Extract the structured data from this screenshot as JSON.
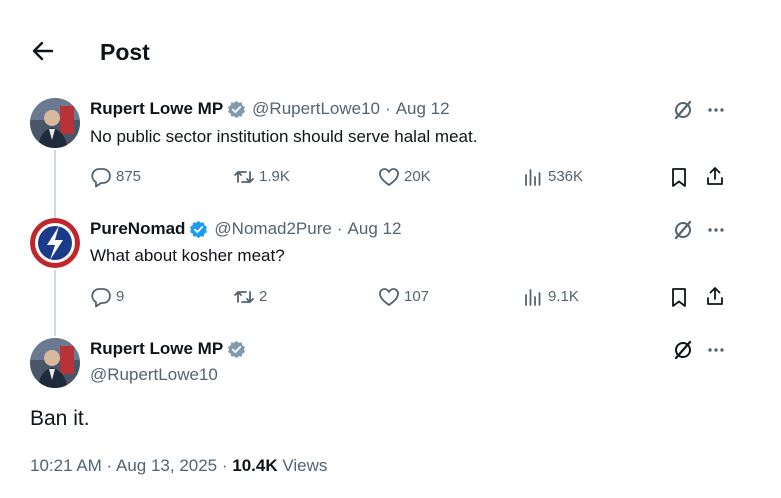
{
  "header": {
    "title": "Post"
  },
  "tweets": [
    {
      "display_name": "Rupert Lowe MP",
      "handle": "@RupertLowe10",
      "date": "Aug 12",
      "text": "No public sector institution should serve halal meat.",
      "replies": "875",
      "retweets": "1.9K",
      "likes": "20K",
      "views": "536K"
    },
    {
      "display_name": "PureNomad",
      "handle": "@Nomad2Pure",
      "date": "Aug 12",
      "text": "What about kosher meat?",
      "replies": "9",
      "retweets": "2",
      "likes": "107",
      "views": "9.1K"
    }
  ],
  "main_tweet": {
    "display_name": "Rupert Lowe MP",
    "handle": "@RupertLowe10",
    "text": "Ban it.",
    "timestamp": "10:21 AM · Aug 13, 2025 · ",
    "view_count": "10.4K",
    "views_label": " Views"
  },
  "separator": "·",
  "colors": {
    "verified": "#1d9bf0",
    "verified_grey": "#829aab",
    "secondary_text": "#536471",
    "thread_line": "#cfd9de"
  }
}
